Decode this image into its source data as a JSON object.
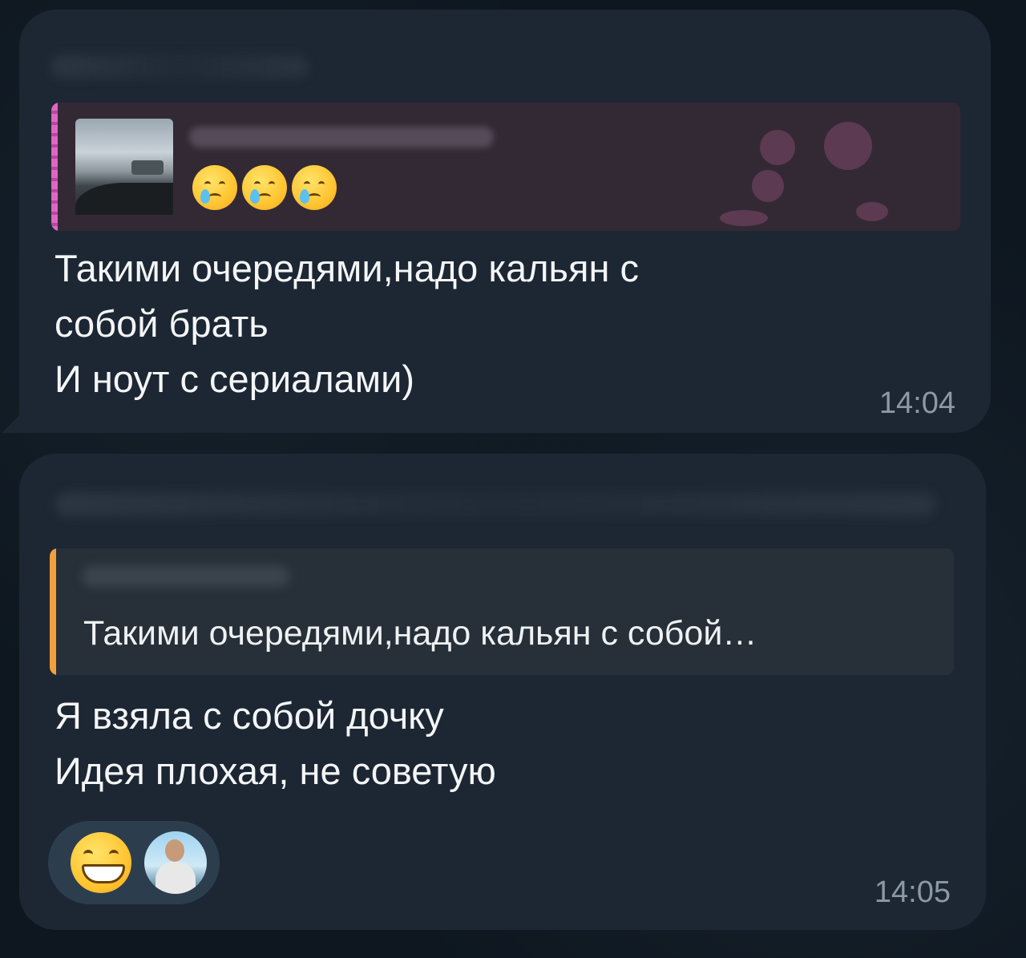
{
  "messages": [
    {
      "reply": {
        "emojis": [
          "crying-face",
          "crying-face",
          "crying-face"
        ]
      },
      "text": "Такими очередями,надо кальян с\nсобой брать\nИ ноут с сериалами)",
      "time": "14:04"
    },
    {
      "reply": {
        "snippet": "Такими очередями,надо кальян с собой…"
      },
      "text": "Я взяла с собой дочку\nИдея плохая, не советую",
      "time": "14:05",
      "reactions": [
        "grinning-face",
        "user-avatar"
      ]
    }
  ],
  "colors": {
    "background": "#0e1720",
    "bubble": "#1d2733",
    "reply_1_bg": "#332935",
    "reply_1_accent": "#e066c2",
    "reply_2_bg": "#272f38",
    "reply_2_accent": "#f2a03c",
    "reaction_pill": "#2c3e4e",
    "time_text": "#8b99a6"
  }
}
